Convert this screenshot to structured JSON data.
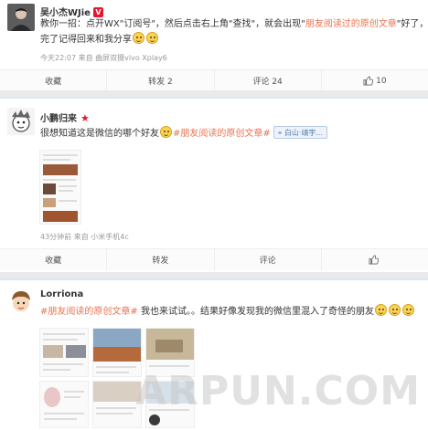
{
  "post1": {
    "author": "吴小杰WJie",
    "badge": "V",
    "text_line1_a": "教你一招：点开WX\"订阅号\"，然后点击右上角\"查找\"，就会出现\"",
    "text_line1_topic": "朋友阅读过的原创文章",
    "text_line1_b": "\"好了，看",
    "text_line2": "完了记得回来和我分享",
    "meta": "今天22:07 来自 曲屏双摄vivo Xplay6",
    "actions": {
      "collect": "收藏",
      "repost": "转发 2",
      "comment": "评论 24",
      "like": "10"
    }
  },
  "post2": {
    "author": "小鹏归来",
    "text_a": "很想知道这是微信的哪个好友",
    "topic": "#朋友阅读的原创文章#",
    "location": "白山·靖宇...",
    "meta": "43分钟前 来自 小米手机4c",
    "actions": {
      "collect": "收藏",
      "repost": "转发",
      "comment": "评论",
      "like": ""
    }
  },
  "post3": {
    "author": "Lorriona",
    "topic": "#朋友阅读的原创文章#",
    "text_a": "我也来试试。。结果好像发现我的微信里混入了奇怪的朋友"
  },
  "watermark": "ARPUN.COM",
  "colors": {
    "topic": "#eb7350",
    "badge": "#e6162d",
    "link": "#507daf"
  },
  "icons": {
    "like": "thumb-up-icon",
    "location": "location-pin-icon",
    "vip": "vip-badge-icon",
    "star": "star-icon"
  }
}
